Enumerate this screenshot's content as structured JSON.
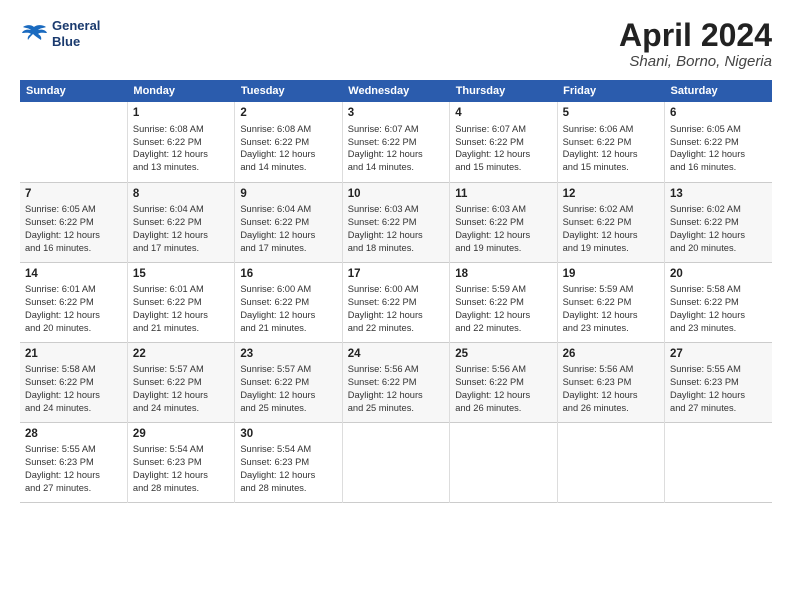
{
  "header": {
    "logo_line1": "General",
    "logo_line2": "Blue",
    "month": "April 2024",
    "location": "Shani, Borno, Nigeria"
  },
  "days_of_week": [
    "Sunday",
    "Monday",
    "Tuesday",
    "Wednesday",
    "Thursday",
    "Friday",
    "Saturday"
  ],
  "weeks": [
    [
      {
        "day": "",
        "info": ""
      },
      {
        "day": "1",
        "info": "Sunrise: 6:08 AM\nSunset: 6:22 PM\nDaylight: 12 hours\nand 13 minutes."
      },
      {
        "day": "2",
        "info": "Sunrise: 6:08 AM\nSunset: 6:22 PM\nDaylight: 12 hours\nand 14 minutes."
      },
      {
        "day": "3",
        "info": "Sunrise: 6:07 AM\nSunset: 6:22 PM\nDaylight: 12 hours\nand 14 minutes."
      },
      {
        "day": "4",
        "info": "Sunrise: 6:07 AM\nSunset: 6:22 PM\nDaylight: 12 hours\nand 15 minutes."
      },
      {
        "day": "5",
        "info": "Sunrise: 6:06 AM\nSunset: 6:22 PM\nDaylight: 12 hours\nand 15 minutes."
      },
      {
        "day": "6",
        "info": "Sunrise: 6:05 AM\nSunset: 6:22 PM\nDaylight: 12 hours\nand 16 minutes."
      }
    ],
    [
      {
        "day": "7",
        "info": "Sunrise: 6:05 AM\nSunset: 6:22 PM\nDaylight: 12 hours\nand 16 minutes."
      },
      {
        "day": "8",
        "info": "Sunrise: 6:04 AM\nSunset: 6:22 PM\nDaylight: 12 hours\nand 17 minutes."
      },
      {
        "day": "9",
        "info": "Sunrise: 6:04 AM\nSunset: 6:22 PM\nDaylight: 12 hours\nand 17 minutes."
      },
      {
        "day": "10",
        "info": "Sunrise: 6:03 AM\nSunset: 6:22 PM\nDaylight: 12 hours\nand 18 minutes."
      },
      {
        "day": "11",
        "info": "Sunrise: 6:03 AM\nSunset: 6:22 PM\nDaylight: 12 hours\nand 19 minutes."
      },
      {
        "day": "12",
        "info": "Sunrise: 6:02 AM\nSunset: 6:22 PM\nDaylight: 12 hours\nand 19 minutes."
      },
      {
        "day": "13",
        "info": "Sunrise: 6:02 AM\nSunset: 6:22 PM\nDaylight: 12 hours\nand 20 minutes."
      }
    ],
    [
      {
        "day": "14",
        "info": "Sunrise: 6:01 AM\nSunset: 6:22 PM\nDaylight: 12 hours\nand 20 minutes."
      },
      {
        "day": "15",
        "info": "Sunrise: 6:01 AM\nSunset: 6:22 PM\nDaylight: 12 hours\nand 21 minutes."
      },
      {
        "day": "16",
        "info": "Sunrise: 6:00 AM\nSunset: 6:22 PM\nDaylight: 12 hours\nand 21 minutes."
      },
      {
        "day": "17",
        "info": "Sunrise: 6:00 AM\nSunset: 6:22 PM\nDaylight: 12 hours\nand 22 minutes."
      },
      {
        "day": "18",
        "info": "Sunrise: 5:59 AM\nSunset: 6:22 PM\nDaylight: 12 hours\nand 22 minutes."
      },
      {
        "day": "19",
        "info": "Sunrise: 5:59 AM\nSunset: 6:22 PM\nDaylight: 12 hours\nand 23 minutes."
      },
      {
        "day": "20",
        "info": "Sunrise: 5:58 AM\nSunset: 6:22 PM\nDaylight: 12 hours\nand 23 minutes."
      }
    ],
    [
      {
        "day": "21",
        "info": "Sunrise: 5:58 AM\nSunset: 6:22 PM\nDaylight: 12 hours\nand 24 minutes."
      },
      {
        "day": "22",
        "info": "Sunrise: 5:57 AM\nSunset: 6:22 PM\nDaylight: 12 hours\nand 24 minutes."
      },
      {
        "day": "23",
        "info": "Sunrise: 5:57 AM\nSunset: 6:22 PM\nDaylight: 12 hours\nand 25 minutes."
      },
      {
        "day": "24",
        "info": "Sunrise: 5:56 AM\nSunset: 6:22 PM\nDaylight: 12 hours\nand 25 minutes."
      },
      {
        "day": "25",
        "info": "Sunrise: 5:56 AM\nSunset: 6:22 PM\nDaylight: 12 hours\nand 26 minutes."
      },
      {
        "day": "26",
        "info": "Sunrise: 5:56 AM\nSunset: 6:23 PM\nDaylight: 12 hours\nand 26 minutes."
      },
      {
        "day": "27",
        "info": "Sunrise: 5:55 AM\nSunset: 6:23 PM\nDaylight: 12 hours\nand 27 minutes."
      }
    ],
    [
      {
        "day": "28",
        "info": "Sunrise: 5:55 AM\nSunset: 6:23 PM\nDaylight: 12 hours\nand 27 minutes."
      },
      {
        "day": "29",
        "info": "Sunrise: 5:54 AM\nSunset: 6:23 PM\nDaylight: 12 hours\nand 28 minutes."
      },
      {
        "day": "30",
        "info": "Sunrise: 5:54 AM\nSunset: 6:23 PM\nDaylight: 12 hours\nand 28 minutes."
      },
      {
        "day": "",
        "info": ""
      },
      {
        "day": "",
        "info": ""
      },
      {
        "day": "",
        "info": ""
      },
      {
        "day": "",
        "info": ""
      }
    ]
  ]
}
